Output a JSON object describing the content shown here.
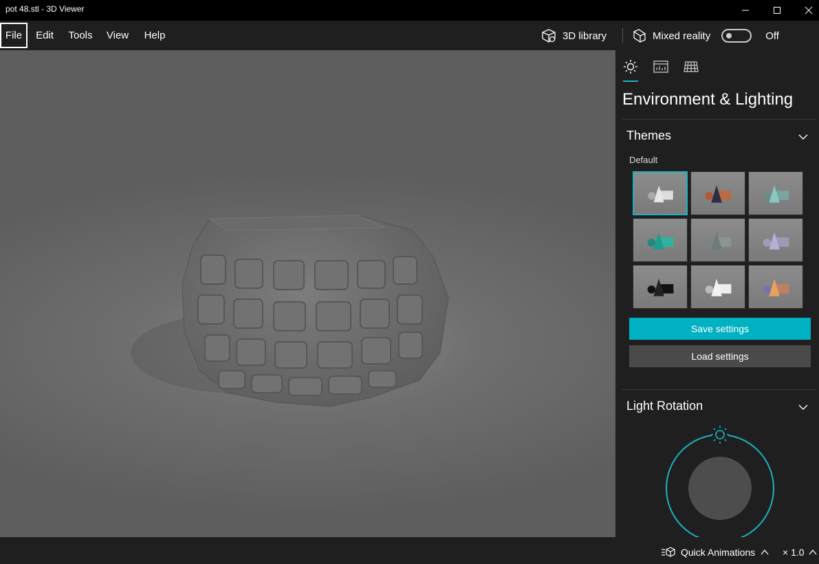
{
  "window": {
    "title": "pot 48.stl - 3D Viewer"
  },
  "menu": {
    "items": [
      "File",
      "Edit",
      "Tools",
      "View",
      "Help"
    ],
    "library_label": "3D library",
    "mixed_reality_label": "Mixed reality",
    "mixed_reality_state": "Off"
  },
  "panel": {
    "tabs": [
      "sun-icon",
      "stats-icon",
      "grid-icon"
    ],
    "title": "Environment & Lighting",
    "themes": {
      "heading": "Themes",
      "selected_label": "Default",
      "save_label": "Save settings",
      "load_label": "Load settings"
    },
    "light_rotation": {
      "heading": "Light Rotation"
    }
  },
  "status": {
    "quick_animations_label": "Quick Animations",
    "speed_label": "× 1.0"
  },
  "colors": {
    "accent": "#00b1c2",
    "panel_bg": "#1f1f1f",
    "titlebar_bg": "#000000"
  }
}
